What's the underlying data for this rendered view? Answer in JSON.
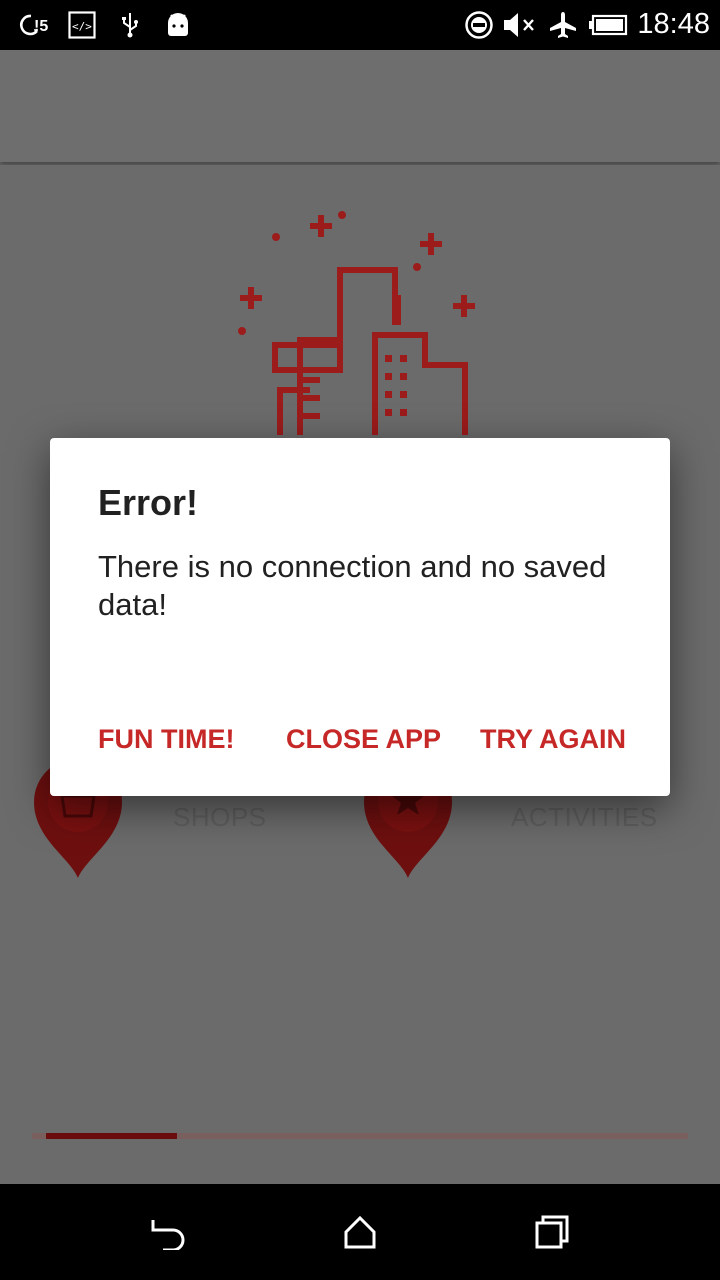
{
  "status_bar": {
    "time": "18:48",
    "left_icons": [
      "sync-alert-icon",
      "developer-code-icon",
      "usb-icon",
      "android-icon"
    ],
    "right_icons": [
      "do-not-disturb-icon",
      "volume-muted-icon",
      "airplane-mode-icon",
      "battery-icon"
    ]
  },
  "categories": [
    {
      "label": "SHOPS",
      "icon": "shop-pin-icon"
    },
    {
      "label": "ACTIVITIES",
      "icon": "star-pin-icon"
    }
  ],
  "progress": {
    "value": 0.2
  },
  "dialog": {
    "title": "Error!",
    "message": "There is no connection and no saved data!",
    "buttons": {
      "fun_time": "FUN TIME!",
      "close_app": "CLOSE APP",
      "try_again": "TRY AGAIN"
    }
  },
  "nav_bar": {
    "icons": [
      "back-icon",
      "home-icon",
      "recents-icon"
    ]
  },
  "colors": {
    "accent": "#c62828",
    "pin": "#7a1010",
    "illustration": "#b01818",
    "scrim": "#6b6b6b"
  }
}
